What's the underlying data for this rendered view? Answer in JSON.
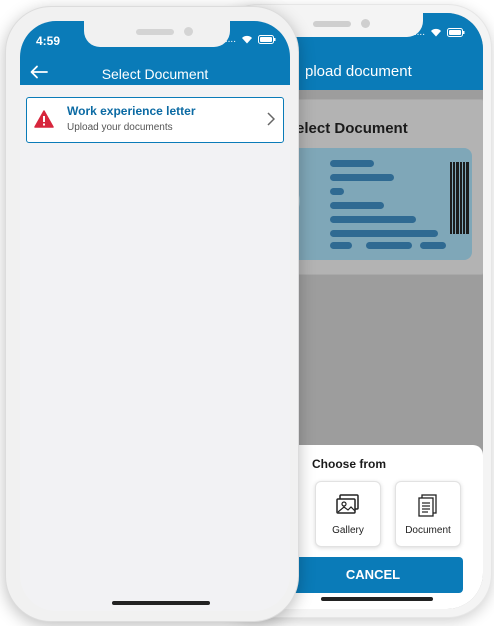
{
  "back_phone": {
    "header_title": "pload document",
    "card_title": "elect Document",
    "sheet": {
      "title": "Choose from",
      "options": [
        {
          "label": "Gallery",
          "icon": "gallery-icon"
        },
        {
          "label": "Document",
          "icon": "document-icon"
        }
      ],
      "cancel_label": "CANCEL"
    },
    "status": {
      "dots": "....",
      "wifi": "wifi-icon",
      "battery": "battery-icon"
    }
  },
  "front_phone": {
    "time": "4:59",
    "header_title": "Select Document",
    "back_icon": "arrow-left-icon",
    "status": {
      "dots": "....",
      "wifi": "wifi-icon",
      "battery": "battery-icon"
    },
    "items": [
      {
        "title": "Work experience letter",
        "subtitle": "Upload your documents",
        "icon": "warning-icon"
      }
    ]
  },
  "colors": {
    "primary": "#0a7bb8",
    "warning": "#d7263d",
    "overlay": "#9d9d9d",
    "id_card": "#7fa7b8",
    "id_bar": "#2f6a92"
  }
}
